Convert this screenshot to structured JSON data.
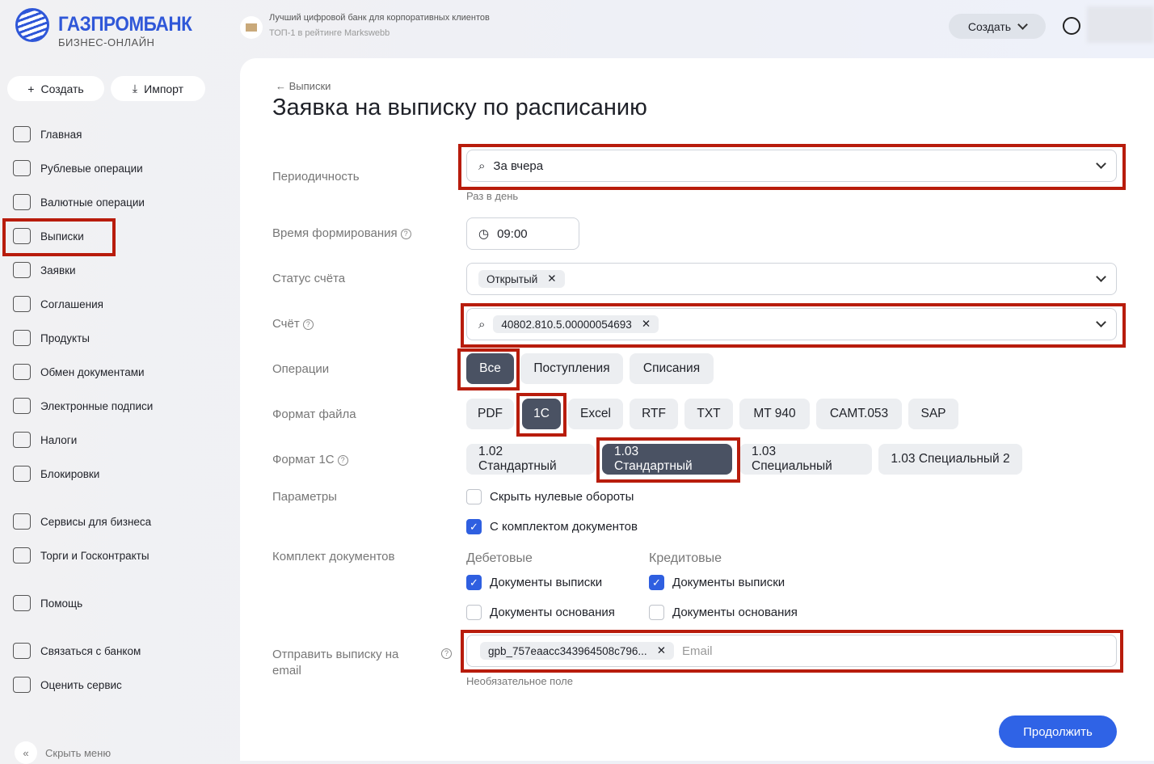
{
  "brand": {
    "name": "ГАЗПРОМБАНК",
    "subtitle": "БИЗНЕС-ОНЛАЙН"
  },
  "promo": {
    "line1": "Лучший цифровой банк для корпоративных клиентов",
    "line2": "ТОП-1 в рейтинге Markswebb"
  },
  "header": {
    "create": "Создать"
  },
  "sidebar": {
    "create": "Создать",
    "import": "Импорт",
    "items": [
      {
        "label": "Главная"
      },
      {
        "label": "Рублевые операции"
      },
      {
        "label": "Валютные операции"
      },
      {
        "label": "Выписки"
      },
      {
        "label": "Заявки"
      },
      {
        "label": "Соглашения"
      },
      {
        "label": "Продукты"
      },
      {
        "label": "Обмен документами"
      },
      {
        "label": "Электронные подписи"
      },
      {
        "label": "Налоги"
      },
      {
        "label": "Блокировки"
      },
      {
        "label": "Сервисы для бизнеса"
      },
      {
        "label": "Торги и Госконтракты"
      },
      {
        "label": "Помощь"
      },
      {
        "label": "Связаться с банком"
      },
      {
        "label": "Оценить сервис"
      }
    ],
    "hide": "Скрыть меню"
  },
  "page": {
    "back": "Выписки",
    "title": "Заявка на выписку по расписанию"
  },
  "form": {
    "periodicity": {
      "label": "Периодичность",
      "value": "За вчера",
      "hint": "Раз в день"
    },
    "time": {
      "label": "Время формирования",
      "value": "09:00"
    },
    "status": {
      "label": "Статус счёта",
      "chip": "Открытый"
    },
    "account": {
      "label": "Счёт",
      "chip": "40802.810.5.00000054693"
    },
    "operations": {
      "label": "Операции",
      "options": [
        "Все",
        "Поступления",
        "Списания"
      ]
    },
    "format": {
      "label": "Формат файла",
      "options": [
        "PDF",
        "1С",
        "Excel",
        "RTF",
        "TXT",
        "MT 940",
        "CAMT.053",
        "SAP"
      ]
    },
    "format1c": {
      "label": "Формат 1С",
      "options": [
        "1.02 Стандартный",
        "1.03 Стандартный",
        "1.03 Специальный",
        "1.03 Специальный 2"
      ]
    },
    "params": {
      "label": "Параметры",
      "hide_zero": "Скрыть нулевые обороты",
      "with_docs": "С комплектом документов"
    },
    "docs": {
      "label": "Комплект документов",
      "debit": "Дебетовые",
      "credit": "Кредитовые",
      "statement_docs": "Документы выписки",
      "basis_docs": "Документы основания"
    },
    "email": {
      "label": "Отправить выписку на email",
      "chip": "gpb_757eaacc343964508c796...",
      "placeholder": "Email",
      "hint": "Необязательное поле"
    },
    "submit": "Продолжить"
  }
}
